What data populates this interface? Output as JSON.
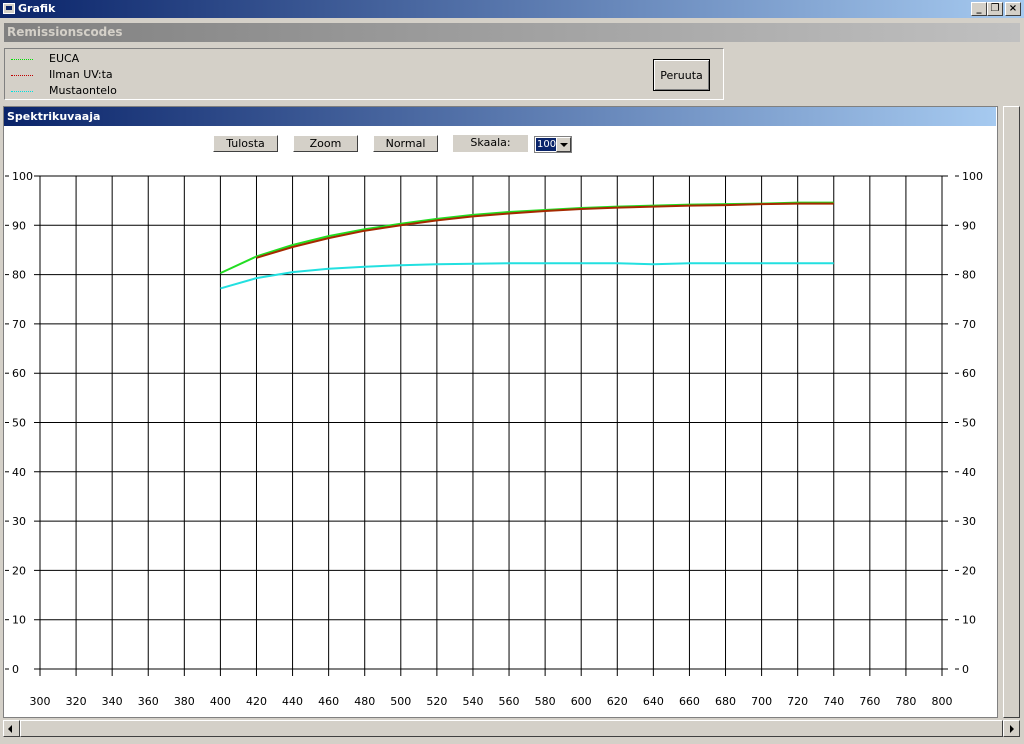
{
  "window": {
    "title": "Grafik"
  },
  "codes_section": {
    "title": "Remissionscodes"
  },
  "legend": [
    {
      "label": "EUCA",
      "color": "#00e000"
    },
    {
      "label": "Ilman UV:ta",
      "color": "#c00000"
    },
    {
      "label": "Mustaontelo",
      "color": "#00e0e0"
    }
  ],
  "cancel_label": "Peruuta",
  "chart_section": {
    "title": "Spektrikuvaaja"
  },
  "toolbar": {
    "print_label": "Tulosta",
    "zoom_label": "Zoom",
    "normal_label": "Normal",
    "scale_label": "Skaala:",
    "scale_value": "100"
  },
  "chart_data": {
    "type": "line",
    "xlim": [
      300,
      800
    ],
    "ylim": [
      0,
      100
    ],
    "x_ticks": [
      300,
      320,
      340,
      360,
      380,
      400,
      420,
      440,
      460,
      480,
      500,
      520,
      540,
      560,
      580,
      600,
      620,
      640,
      660,
      680,
      700,
      720,
      740,
      760,
      780,
      800
    ],
    "y_ticks": [
      0,
      10,
      20,
      30,
      40,
      50,
      60,
      70,
      80,
      90,
      100
    ],
    "grid": true,
    "x": [
      400,
      420,
      440,
      460,
      480,
      500,
      520,
      540,
      560,
      580,
      600,
      620,
      640,
      660,
      680,
      700,
      720,
      740
    ],
    "series": [
      {
        "name": "EUCA",
        "color": "#22dd22",
        "values": [
          80.3,
          83.7,
          86.0,
          87.8,
          89.2,
          90.3,
          91.3,
          92.1,
          92.7,
          93.1,
          93.5,
          93.8,
          94.0,
          94.2,
          94.3,
          94.4,
          94.6,
          94.6
        ]
      },
      {
        "name": "Ilman UV:ta",
        "color": "#a52a00",
        "values": [
          null,
          83.4,
          85.6,
          87.4,
          88.9,
          90.0,
          91.0,
          91.8,
          92.4,
          92.9,
          93.3,
          93.6,
          93.8,
          94.0,
          94.1,
          94.3,
          94.4,
          94.4
        ]
      },
      {
        "name": "Mustaontelo",
        "color": "#22e0e0",
        "values": [
          77.2,
          79.3,
          80.5,
          81.2,
          81.6,
          81.9,
          82.1,
          82.2,
          82.3,
          82.3,
          82.3,
          82.3,
          82.1,
          82.3,
          82.3,
          82.3,
          82.3,
          82.3
        ]
      }
    ]
  }
}
